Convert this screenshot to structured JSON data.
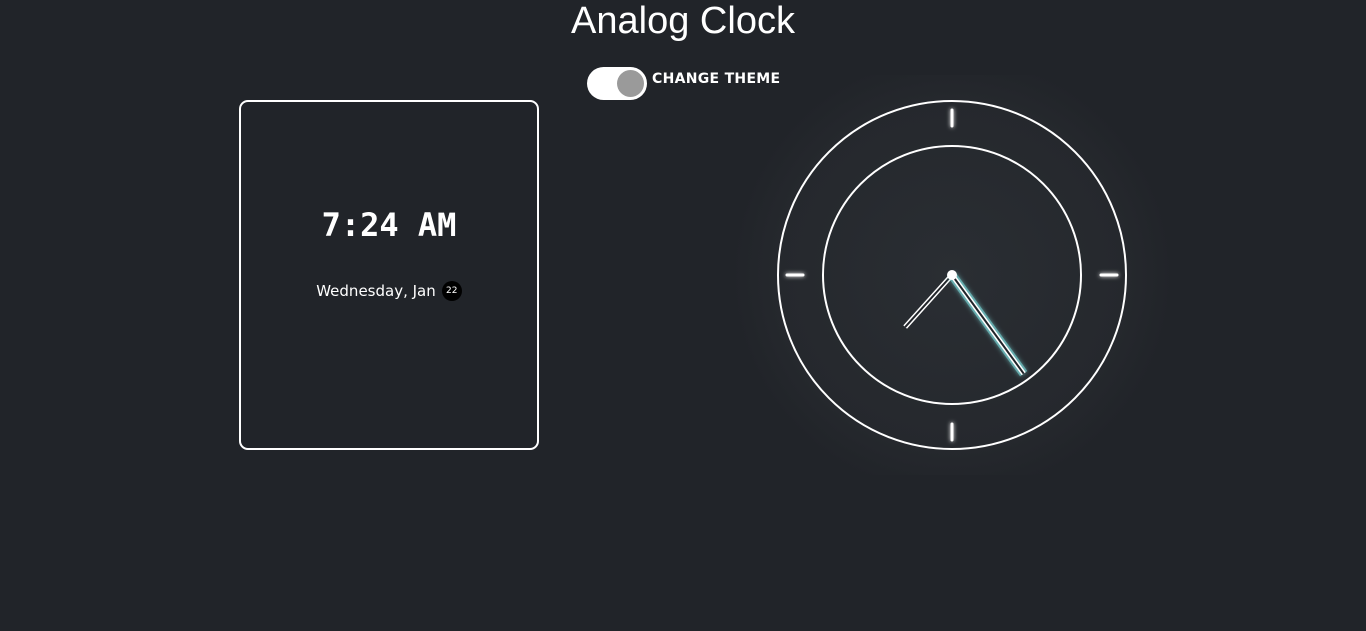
{
  "page": {
    "title": "Analog Clock"
  },
  "theme_toggle": {
    "label": "CHANGE THEME",
    "state": "on"
  },
  "digital_clock": {
    "time": "7:24 AM",
    "date_text": "Wednesday, Jan",
    "day": "22"
  },
  "analog_clock": {
    "hour": 7,
    "minute": 24,
    "hand_color": "#ffffff",
    "glow_color": "#7fe0e0"
  },
  "colors": {
    "background": "#212429",
    "foreground": "#ffffff",
    "toggle_knob": "#9a9a9a"
  }
}
